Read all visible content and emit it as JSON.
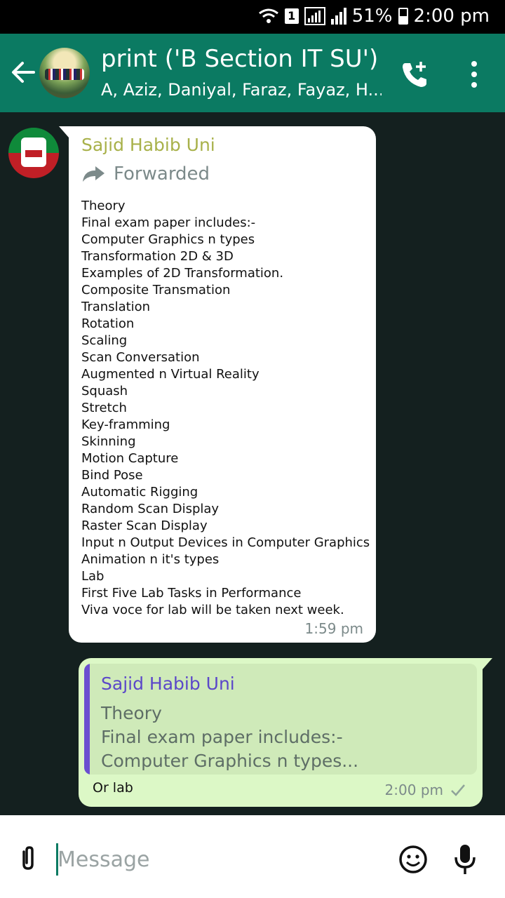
{
  "status_bar": {
    "sim_slot": "1",
    "battery_percent": "51%",
    "time": "2:00 pm",
    "battery_level": 0.51
  },
  "header": {
    "title": "print ('B Section IT SU')",
    "subtitle": "A, Aziz, Daniyal, Faraz, Fayaz, H...",
    "accent_color": "#0b7a62"
  },
  "messages": {
    "incoming": {
      "sender": "Sajid Habib Uni",
      "forwarded_label": "Forwarded",
      "lines": [
        "Theory",
        "Final exam paper includes:-",
        "Computer Graphics n types",
        "Transformation 2D & 3D",
        "Examples of 2D Transformation.",
        "Composite Transmation",
        "Translation",
        "Rotation",
        "Scaling",
        "Scan Conversation",
        "Augmented n Virtual Reality",
        "Squash",
        "Stretch",
        "Key-framming",
        "Skinning",
        "Motion Capture",
        "Bind Pose",
        "Automatic Rigging",
        "Random Scan Display",
        "Raster Scan Display",
        "Input n Output Devices in Computer Graphics",
        "Animation n it's types",
        "Lab",
        "First Five Lab Tasks in Performance",
        "Viva voce for lab will be taken next week."
      ],
      "time": "1:59 pm"
    },
    "outgoing": {
      "quote_sender": "Sajid Habib Uni",
      "quote_lines": [
        "Theory",
        "Final exam paper includes:-",
        "Computer Graphics n types..."
      ],
      "text": "Or lab",
      "time": "2:00 pm",
      "status_icon": "single-check-icon"
    }
  },
  "composer": {
    "placeholder": "Message",
    "icons": [
      "attach-icon",
      "emoji-icon",
      "mic-icon"
    ]
  }
}
